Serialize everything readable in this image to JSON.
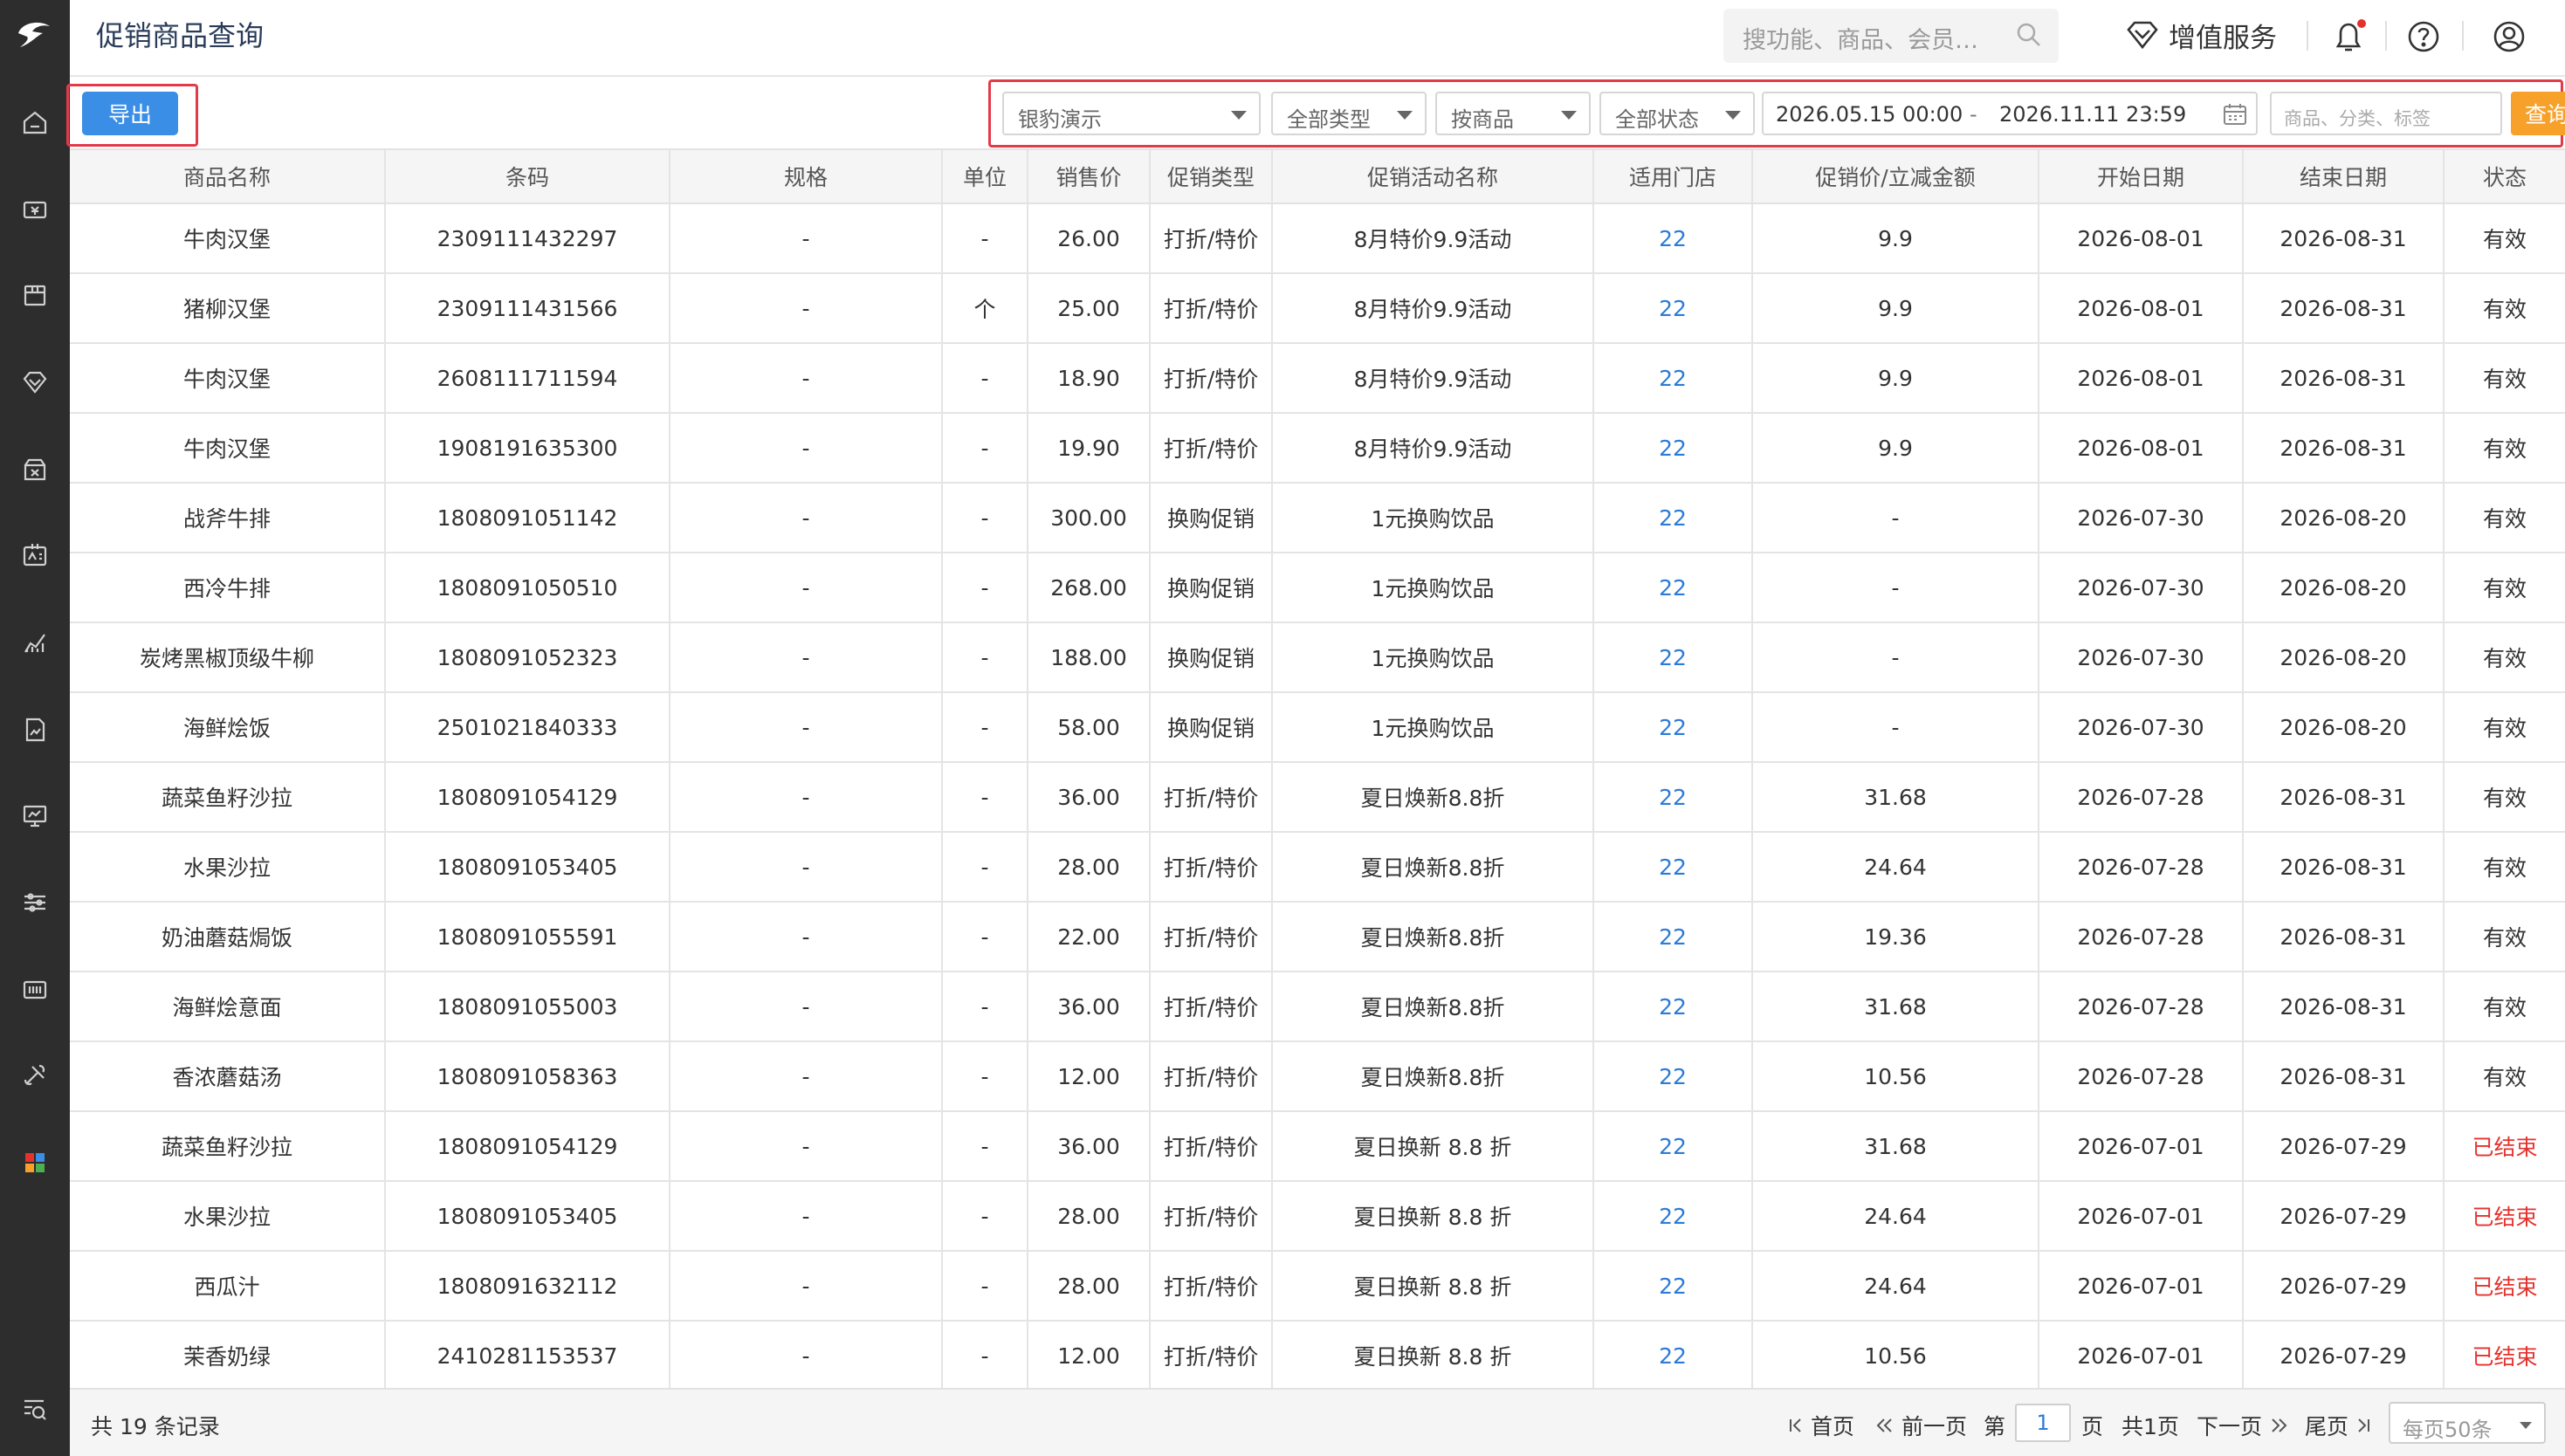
{
  "header": {
    "title": "促销商品查询",
    "search_placeholder": "搜功能、商品、会员…",
    "value_added_label": "增值服务"
  },
  "toolbar": {
    "export_label": "导出",
    "store_select": "银豹演示",
    "type_select": "全部类型",
    "scope_select": "按商品",
    "status_select": "全部状态",
    "date_start": "2026.05.15 00:00",
    "date_sep": "-",
    "date_end": "2026.11.11 23:59",
    "keyword_placeholder": "商品、分类、标签",
    "query_label": "查询"
  },
  "table": {
    "columns": [
      "商品名称",
      "条码",
      "规格",
      "单位",
      "销售价",
      "促销类型",
      "促销活动名称",
      "适用门店",
      "促销价/立减金额",
      "开始日期",
      "结束日期",
      "状态"
    ],
    "rows": [
      [
        "牛肉汉堡",
        "2309111432297",
        "-",
        "-",
        "26.00",
        "打折/特价",
        "8月特价9.9活动",
        "22",
        "9.9",
        "2026-08-01",
        "2026-08-31",
        "有效"
      ],
      [
        "猪柳汉堡",
        "2309111431566",
        "-",
        "个",
        "25.00",
        "打折/特价",
        "8月特价9.9活动",
        "22",
        "9.9",
        "2026-08-01",
        "2026-08-31",
        "有效"
      ],
      [
        "牛肉汉堡",
        "2608111711594",
        "-",
        "-",
        "18.90",
        "打折/特价",
        "8月特价9.9活动",
        "22",
        "9.9",
        "2026-08-01",
        "2026-08-31",
        "有效"
      ],
      [
        "牛肉汉堡",
        "1908191635300",
        "-",
        "-",
        "19.90",
        "打折/特价",
        "8月特价9.9活动",
        "22",
        "9.9",
        "2026-08-01",
        "2026-08-31",
        "有效"
      ],
      [
        "战斧牛排",
        "1808091051142",
        "-",
        "-",
        "300.00",
        "换购促销",
        "1元换购饮品",
        "22",
        "-",
        "2026-07-30",
        "2026-08-20",
        "有效"
      ],
      [
        "西冷牛排",
        "1808091050510",
        "-",
        "-",
        "268.00",
        "换购促销",
        "1元换购饮品",
        "22",
        "-",
        "2026-07-30",
        "2026-08-20",
        "有效"
      ],
      [
        "炭烤黑椒顶级牛柳",
        "1808091052323",
        "-",
        "-",
        "188.00",
        "换购促销",
        "1元换购饮品",
        "22",
        "-",
        "2026-07-30",
        "2026-08-20",
        "有效"
      ],
      [
        "海鲜烩饭",
        "2501021840333",
        "-",
        "-",
        "58.00",
        "换购促销",
        "1元换购饮品",
        "22",
        "-",
        "2026-07-30",
        "2026-08-20",
        "有效"
      ],
      [
        "蔬菜鱼籽沙拉",
        "1808091054129",
        "-",
        "-",
        "36.00",
        "打折/特价",
        "夏日焕新8.8折",
        "22",
        "31.68",
        "2026-07-28",
        "2026-08-31",
        "有效"
      ],
      [
        "水果沙拉",
        "1808091053405",
        "-",
        "-",
        "28.00",
        "打折/特价",
        "夏日焕新8.8折",
        "22",
        "24.64",
        "2026-07-28",
        "2026-08-31",
        "有效"
      ],
      [
        "奶油蘑菇焗饭",
        "1808091055591",
        "-",
        "-",
        "22.00",
        "打折/特价",
        "夏日焕新8.8折",
        "22",
        "19.36",
        "2026-07-28",
        "2026-08-31",
        "有效"
      ],
      [
        "海鲜烩意面",
        "1808091055003",
        "-",
        "-",
        "36.00",
        "打折/特价",
        "夏日焕新8.8折",
        "22",
        "31.68",
        "2026-07-28",
        "2026-08-31",
        "有效"
      ],
      [
        "香浓蘑菇汤",
        "1808091058363",
        "-",
        "-",
        "12.00",
        "打折/特价",
        "夏日焕新8.8折",
        "22",
        "10.56",
        "2026-07-28",
        "2026-08-31",
        "有效"
      ],
      [
        "蔬菜鱼籽沙拉",
        "1808091054129",
        "-",
        "-",
        "36.00",
        "打折/特价",
        "夏日换新 8.8 折",
        "22",
        "31.68",
        "2026-07-01",
        "2026-07-29",
        "已结束"
      ],
      [
        "水果沙拉",
        "1808091053405",
        "-",
        "-",
        "28.00",
        "打折/特价",
        "夏日换新 8.8 折",
        "22",
        "24.64",
        "2026-07-01",
        "2026-07-29",
        "已结束"
      ],
      [
        "西瓜汁",
        "1808091632112",
        "-",
        "-",
        "28.00",
        "打折/特价",
        "夏日换新 8.8 折",
        "22",
        "24.64",
        "2026-07-01",
        "2026-07-29",
        "已结束"
      ],
      [
        "茉香奶绿",
        "2410281153537",
        "-",
        "-",
        "12.00",
        "打折/特价",
        "夏日换新 8.8 折",
        "22",
        "10.56",
        "2026-07-01",
        "2026-07-29",
        "已结束"
      ]
    ]
  },
  "footer": {
    "total_label": "共 19 条记录",
    "first": "首页",
    "prev": "前一页",
    "page_prefix": "第",
    "page_value": "1",
    "page_suffix": "页",
    "page_total": "共1页",
    "next": "下一页",
    "last": "尾页",
    "page_size": "每页50条"
  },
  "colors": {
    "primary": "#3a8ee6",
    "query": "#f7a12b",
    "link": "#2b7bd8",
    "ended": "#e5322d",
    "highlight": "#e33a4a",
    "sidebar": "#2d2d2d"
  },
  "icons": [
    "logo-icon",
    "home-icon",
    "cashier-icon",
    "product-box-icon",
    "diamond-icon",
    "promotion-icon",
    "member-card-icon",
    "chart-icon",
    "report-icon",
    "monitor-icon",
    "settings-sliders-icon",
    "terminal-icon",
    "tools-icon",
    "apps-icon",
    "search-list-icon",
    "search-icon",
    "bell-icon",
    "help-icon",
    "user-icon",
    "calendar-icon"
  ]
}
